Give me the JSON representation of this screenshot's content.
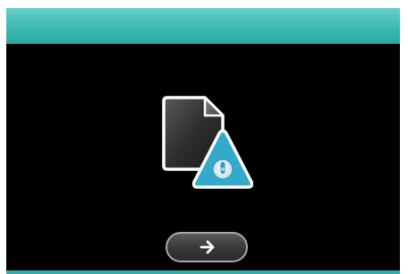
{
  "header": {
    "title": ""
  },
  "error_screen": {
    "icon": "document-warning-icon",
    "badge_icon": "info-exclamation-icon"
  },
  "next_button": {
    "icon": "arrow-right-icon"
  },
  "colors": {
    "header": "#3cb9b3",
    "screen_background": "#000000",
    "warning_triangle": "#33a9cc",
    "button_border": "#a9a9a9"
  }
}
